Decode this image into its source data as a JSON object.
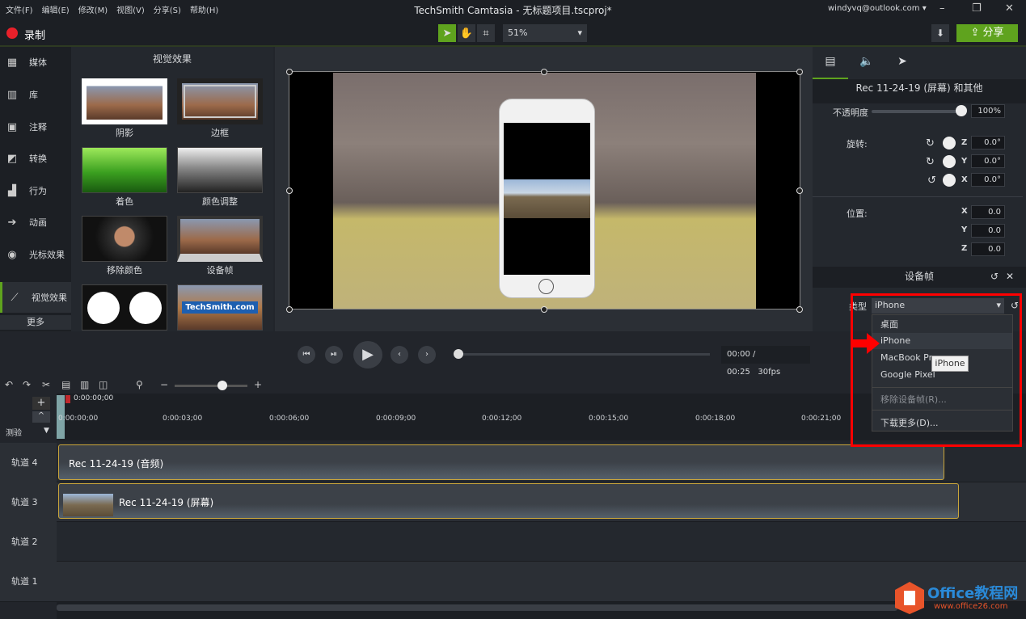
{
  "menu": [
    "文件(F)",
    "编辑(E)",
    "修改(M)",
    "视图(V)",
    "分享(S)",
    "帮助(H)"
  ],
  "app_title": "TechSmith Camtasia - 无标题项目.tscproj*",
  "account": "windyvq@outlook.com ▾",
  "window_controls": [
    "–",
    "❐",
    "✕"
  ],
  "toolbar": {
    "record": "录制",
    "zoom": "51%",
    "share": "分享",
    "accent": "#5fa31e",
    "record_color": "#e8202a"
  },
  "sidebar": {
    "items": [
      "媒体",
      "库",
      "注释",
      "转换",
      "行为",
      "动画",
      "光标效果",
      "视觉效果"
    ],
    "icons": [
      "film-icon",
      "library-icon",
      "annotation-icon",
      "transition-icon",
      "behavior-icon",
      "animation-icon",
      "cursor-effect-icon",
      "visual-effect-icon"
    ],
    "active": "视觉效果",
    "more": "更多"
  },
  "effects": {
    "title": "视觉效果",
    "items": [
      "阴影",
      "边框",
      "着色",
      "颜色调整",
      "移除颜色",
      "设备帧",
      "",
      ""
    ],
    "last_thumb_text": "TechSmith.com"
  },
  "playback": {
    "time": "00:00 / 00:25",
    "fps": "30fps"
  },
  "properties": {
    "clip": "Rec 11-24-19 (屏幕) 和其他",
    "opacity_label": "不透明度",
    "opacity": "100%",
    "opacity_value": 1.0,
    "rotation_label": "旋转:",
    "rotation": [
      {
        "axis": "Z",
        "value": "0.0°"
      },
      {
        "axis": "Y",
        "value": "0.0°"
      },
      {
        "axis": "X",
        "value": "0.0°"
      }
    ],
    "position_label": "位置:",
    "position": [
      {
        "axis": "X",
        "value": "0.0"
      },
      {
        "axis": "Y",
        "value": "0.0"
      },
      {
        "axis": "Z",
        "value": "0.0"
      }
    ],
    "device_frame": "设备帧",
    "type_label": "类型",
    "type_value": "iPhone"
  },
  "dropdown": {
    "options": [
      "桌面",
      "iPhone",
      "MacBook Pro",
      "Google Pixel"
    ],
    "remove": "移除设备帧(R)...",
    "download": "下载更多(D)...",
    "tooltip": "iPhone"
  },
  "timeline": {
    "playhead": "0:00:00;00",
    "ticks": [
      "0:00:00;00",
      "0:00:03;00",
      "0:00:06;00",
      "0:00:09;00",
      "0:00:12;00",
      "0:00:15;00",
      "0:00:18;00",
      "0:00:21;00"
    ],
    "marker_label": "测验",
    "tracks": [
      {
        "name": "轨道 4",
        "clip": "Rec 11-24-19 (音频)"
      },
      {
        "name": "轨道 3",
        "clip": "Rec 11-24-19 (屏幕)"
      },
      {
        "name": "轨道 2",
        "clip": ""
      },
      {
        "name": "轨道 1",
        "clip": ""
      }
    ]
  },
  "watermark": {
    "brand": "Office教程网",
    "url": "www.office26.com"
  }
}
